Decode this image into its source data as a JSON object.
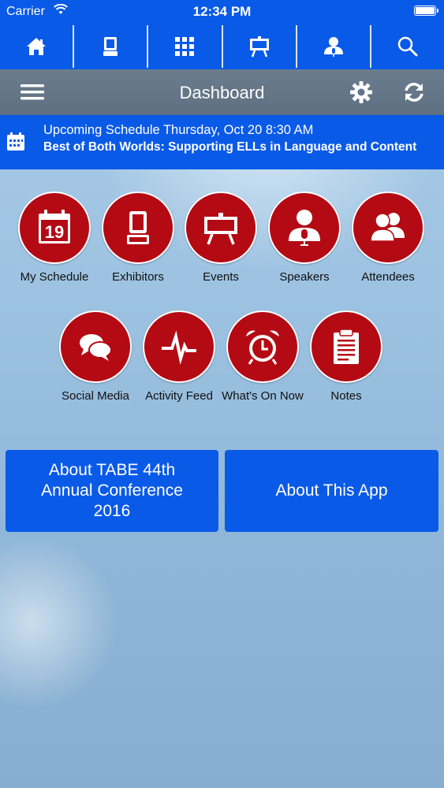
{
  "status_bar": {
    "carrier": "Carrier",
    "time": "12:34 PM"
  },
  "top_nav": {
    "items": [
      {
        "icon": "home-icon"
      },
      {
        "icon": "booth-icon"
      },
      {
        "icon": "floor-plan-icon"
      },
      {
        "icon": "presentation-easel-icon"
      },
      {
        "icon": "speaker-icon"
      },
      {
        "icon": "search-icon"
      }
    ]
  },
  "header": {
    "title": "Dashboard"
  },
  "upcoming": {
    "line1": "Upcoming Schedule Thursday, Oct 20 8:30 AM",
    "line2": "Best of Both Worlds: Supporting ELLs in Language and Content"
  },
  "tiles": [
    {
      "label": "My Schedule",
      "icon": "calendar-icon",
      "calendar_day": "19"
    },
    {
      "label": "Exhibitors",
      "icon": "booth-icon"
    },
    {
      "label": "Events",
      "icon": "presentation-easel-icon"
    },
    {
      "label": "Speakers",
      "icon": "speaker-icon"
    },
    {
      "label": "Attendees",
      "icon": "people-icon"
    },
    {
      "label": "Social Media",
      "icon": "chat-bubbles-icon"
    },
    {
      "label": "Activity Feed",
      "icon": "pulse-icon"
    },
    {
      "label": "What's On Now",
      "icon": "alarm-clock-icon"
    },
    {
      "label": "Notes",
      "icon": "clipboard-icon"
    }
  ],
  "about_buttons": [
    {
      "label": "About TABE 44th Annual Conference 2016"
    },
    {
      "label": "About This App"
    }
  ],
  "colors": {
    "brand_blue": "#0a5ae8",
    "tile_red": "#b40a14",
    "header_gray": "#64768a"
  }
}
